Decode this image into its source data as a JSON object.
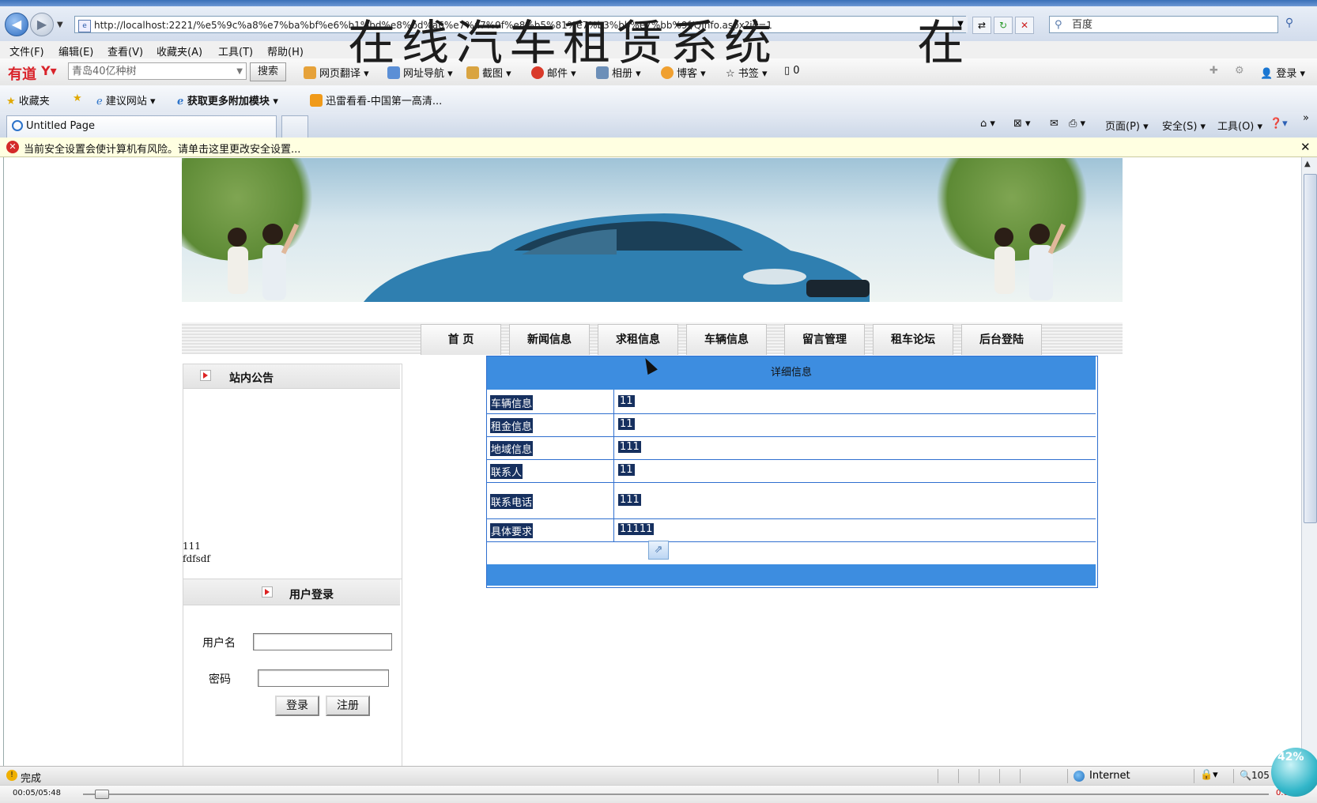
{
  "browser": {
    "address_url": "http://localhost:2221/%e5%9c%a8%e7%ba%bf%e6%b1%bd%e8%bd%a6%e7%a7%9f%e8%b5%81%e7%b3%bb%e7%bb%9f/QInfo.aspx?id=1",
    "search_value": "百度",
    "menu": [
      "文件(F)",
      "编辑(E)",
      "查看(V)",
      "收藏夹(A)",
      "工具(T)",
      "帮助(H)"
    ],
    "youdao": {
      "logo": "有道",
      "search_value": "青岛40亿种树",
      "search_button": "搜索",
      "items": [
        "网页翻译",
        "网址导航",
        "截图",
        "邮件",
        "相册",
        "博客",
        "书签",
        "0"
      ],
      "login": "登录"
    },
    "favorites": {
      "label": "收藏夹",
      "items": [
        "建议网站",
        "获取更多附加模块",
        "迅雷看看-中国第一高清..."
      ]
    },
    "tab_title": "Untitled Page",
    "commands": [
      "页面(P)",
      "安全(S)",
      "工具(O)"
    ],
    "info_bar": "当前安全设置会使计算机有风险。请单击这里更改安全设置...",
    "status": {
      "text": "完成",
      "zone": "Internet",
      "zoom": "105"
    },
    "player": {
      "time": "00:05/05:48",
      "speed": "0.09K"
    },
    "float_percent": "42%"
  },
  "site": {
    "banner_title": "在线汽车租赁系统",
    "banner_title_repeat": "在",
    "nav": [
      "首 页",
      "新闻信息",
      "求租信息",
      "车辆信息",
      "留言管理",
      "租车论坛",
      "后台登陆"
    ],
    "notice": {
      "title": "站内公告",
      "items": [
        "111",
        "fdfsdf"
      ]
    },
    "login": {
      "title": "用户登录",
      "username_label": "用户名",
      "password_label": "密码",
      "login_button": "登录",
      "register_button": "注册"
    },
    "detail": {
      "header": "详细信息",
      "rows": [
        {
          "label": "车辆信息",
          "value": "11"
        },
        {
          "label": "租金信息",
          "value": "11"
        },
        {
          "label": "地域信息",
          "value": "111"
        },
        {
          "label": "联系人",
          "value": "11"
        },
        {
          "label": "联系电话",
          "value": "111"
        },
        {
          "label": "具体要求",
          "value": "11111"
        }
      ]
    }
  },
  "colors": {
    "table_blue": "#3d8de0",
    "selection": "#16305f",
    "info_bg": "#ffffe1"
  }
}
